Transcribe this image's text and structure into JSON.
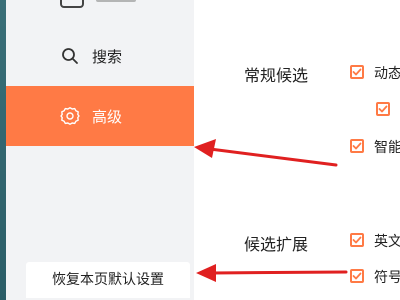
{
  "sidebar": {
    "items": [
      {
        "label": "搜索",
        "icon": "search-icon"
      },
      {
        "label": "高级",
        "icon": "gear-icon",
        "active": true
      }
    ],
    "reset_button": "恢复本页默认设置"
  },
  "main": {
    "sections": [
      {
        "title": "常规候选",
        "options": [
          {
            "text": "动态",
            "checked": true
          },
          {
            "text": "",
            "checked": true
          },
          {
            "text": "智能",
            "checked": true
          }
        ]
      },
      {
        "title": "候选扩展",
        "options": [
          {
            "text": "英文",
            "checked": true
          },
          {
            "text": "符号",
            "checked": true
          }
        ]
      }
    ]
  },
  "colors": {
    "accent": "#ff7a45",
    "sidebar_bg": "#f2f3f5",
    "arrow": "#e02020"
  }
}
